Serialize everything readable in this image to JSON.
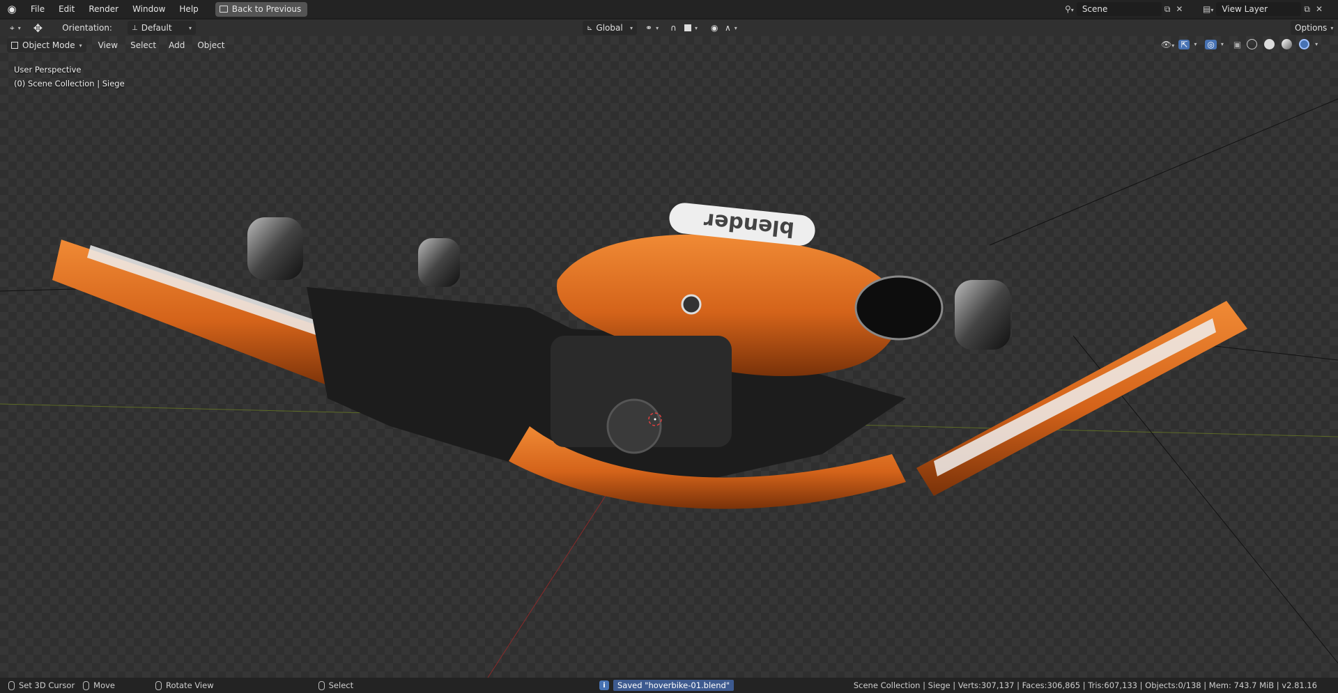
{
  "menubar": {
    "items": [
      "File",
      "Edit",
      "Render",
      "Window",
      "Help"
    ],
    "back_button": "Back to Previous",
    "scene_field": "Scene",
    "view_layer_field": "View Layer"
  },
  "toolbar": {
    "orientation_label": "Orientation:",
    "orientation_value": "Default",
    "transform_space": "Global",
    "options_label": "Options"
  },
  "viewport": {
    "mode": "Object Mode",
    "menu": [
      "View",
      "Select",
      "Add",
      "Object"
    ],
    "perspective_label": "User Perspective",
    "collection_label": "(0) Scene Collection | Siege",
    "decal_text": "blender"
  },
  "statusbar": {
    "set_cursor": "Set 3D Cursor",
    "move": "Move",
    "rotate_view": "Rotate View",
    "select": "Select",
    "saved_message": "Saved \"hoverbike-01.blend\"",
    "stats": "Scene Collection | Siege | Verts:307,137 | Faces:306,865 | Tris:607,133 | Objects:0/138 | Mem: 743.7 MiB | v2.81.16"
  },
  "colors": {
    "accent_orange": "#e0701c",
    "ui_blue": "#4772b3",
    "viewport_bg": "#2f2f2f"
  }
}
